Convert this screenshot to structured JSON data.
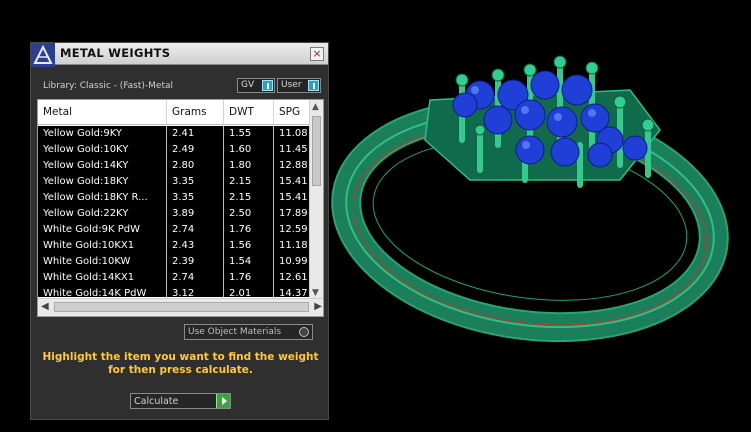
{
  "panel": {
    "title": "METAL WEIGHTS",
    "close_glyph": "×",
    "library_label": "Library: Classic - (Fast)-Metal",
    "toggle_gv": "GV",
    "toggle_user": "User",
    "use_object_materials": "Use Object Materials",
    "instruction_line1": "Highlight the item you want to find the weight",
    "instruction_line2": "for then press calculate.",
    "calculate_label": "Calculate"
  },
  "table": {
    "columns": [
      "Metal",
      "Grams",
      "DWT",
      "SPG"
    ],
    "rows": [
      [
        "Yellow Gold:9KY",
        "2.41",
        "1.55",
        "11.08"
      ],
      [
        "Yellow Gold:10KY",
        "2.49",
        "1.60",
        "11.45"
      ],
      [
        "Yellow Gold:14KY",
        "2.80",
        "1.80",
        "12.88"
      ],
      [
        "Yellow Gold:18KY",
        "3.35",
        "2.15",
        "15.41"
      ],
      [
        "Yellow Gold:18KY R...",
        "3.35",
        "2.15",
        "15.41"
      ],
      [
        "Yellow Gold:22KY",
        "3.89",
        "2.50",
        "17.89"
      ],
      [
        "White Gold:9K PdW",
        "2.74",
        "1.76",
        "12.59"
      ],
      [
        "White Gold:10KX1",
        "2.43",
        "1.56",
        "11.18"
      ],
      [
        "White Gold:10KW",
        "2.39",
        "1.54",
        "10.99"
      ],
      [
        "White Gold:14KX1",
        "2.74",
        "1.76",
        "12.61"
      ],
      [
        "White Gold:14K PdW",
        "3.12",
        "2.01",
        "14.37"
      ]
    ]
  },
  "icons": {
    "logo": "matrix-logo-icon",
    "close": "close-icon",
    "toggle": "toggle-switch-icon",
    "radio": "radio-button-icon",
    "go": "play-arrow-icon"
  },
  "colors": {
    "panel_bg": "#2f2f2f",
    "instruction": "#ffc93a",
    "ring": "#1a9a6a",
    "gem": "#1f3fd6",
    "toggle_on": "#2e9fbf",
    "calc_go": "#3ca43c"
  }
}
